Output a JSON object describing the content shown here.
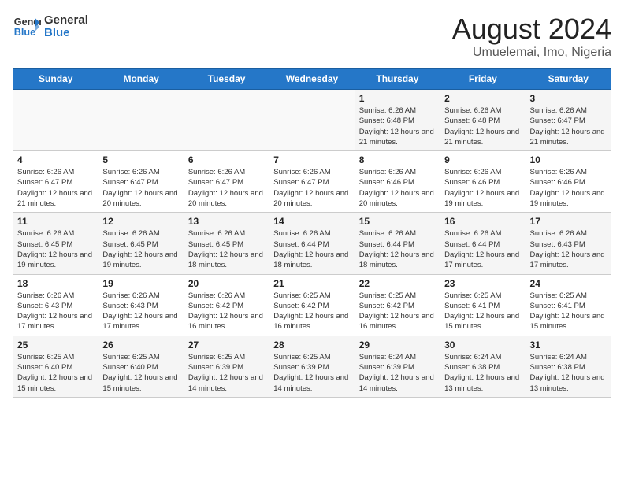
{
  "logo": {
    "line1": "General",
    "line2": "Blue"
  },
  "title": "August 2024",
  "subtitle": "Umuelemai, Imo, Nigeria",
  "weekdays": [
    "Sunday",
    "Monday",
    "Tuesday",
    "Wednesday",
    "Thursday",
    "Friday",
    "Saturday"
  ],
  "weeks": [
    [
      {
        "day": "",
        "info": ""
      },
      {
        "day": "",
        "info": ""
      },
      {
        "day": "",
        "info": ""
      },
      {
        "day": "",
        "info": ""
      },
      {
        "day": "1",
        "info": "Sunrise: 6:26 AM\nSunset: 6:48 PM\nDaylight: 12 hours and 21 minutes."
      },
      {
        "day": "2",
        "info": "Sunrise: 6:26 AM\nSunset: 6:48 PM\nDaylight: 12 hours and 21 minutes."
      },
      {
        "day": "3",
        "info": "Sunrise: 6:26 AM\nSunset: 6:47 PM\nDaylight: 12 hours and 21 minutes."
      }
    ],
    [
      {
        "day": "4",
        "info": "Sunrise: 6:26 AM\nSunset: 6:47 PM\nDaylight: 12 hours and 21 minutes."
      },
      {
        "day": "5",
        "info": "Sunrise: 6:26 AM\nSunset: 6:47 PM\nDaylight: 12 hours and 20 minutes."
      },
      {
        "day": "6",
        "info": "Sunrise: 6:26 AM\nSunset: 6:47 PM\nDaylight: 12 hours and 20 minutes."
      },
      {
        "day": "7",
        "info": "Sunrise: 6:26 AM\nSunset: 6:47 PM\nDaylight: 12 hours and 20 minutes."
      },
      {
        "day": "8",
        "info": "Sunrise: 6:26 AM\nSunset: 6:46 PM\nDaylight: 12 hours and 20 minutes."
      },
      {
        "day": "9",
        "info": "Sunrise: 6:26 AM\nSunset: 6:46 PM\nDaylight: 12 hours and 19 minutes."
      },
      {
        "day": "10",
        "info": "Sunrise: 6:26 AM\nSunset: 6:46 PM\nDaylight: 12 hours and 19 minutes."
      }
    ],
    [
      {
        "day": "11",
        "info": "Sunrise: 6:26 AM\nSunset: 6:45 PM\nDaylight: 12 hours and 19 minutes."
      },
      {
        "day": "12",
        "info": "Sunrise: 6:26 AM\nSunset: 6:45 PM\nDaylight: 12 hours and 19 minutes."
      },
      {
        "day": "13",
        "info": "Sunrise: 6:26 AM\nSunset: 6:45 PM\nDaylight: 12 hours and 18 minutes."
      },
      {
        "day": "14",
        "info": "Sunrise: 6:26 AM\nSunset: 6:44 PM\nDaylight: 12 hours and 18 minutes."
      },
      {
        "day": "15",
        "info": "Sunrise: 6:26 AM\nSunset: 6:44 PM\nDaylight: 12 hours and 18 minutes."
      },
      {
        "day": "16",
        "info": "Sunrise: 6:26 AM\nSunset: 6:44 PM\nDaylight: 12 hours and 17 minutes."
      },
      {
        "day": "17",
        "info": "Sunrise: 6:26 AM\nSunset: 6:43 PM\nDaylight: 12 hours and 17 minutes."
      }
    ],
    [
      {
        "day": "18",
        "info": "Sunrise: 6:26 AM\nSunset: 6:43 PM\nDaylight: 12 hours and 17 minutes."
      },
      {
        "day": "19",
        "info": "Sunrise: 6:26 AM\nSunset: 6:43 PM\nDaylight: 12 hours and 17 minutes."
      },
      {
        "day": "20",
        "info": "Sunrise: 6:26 AM\nSunset: 6:42 PM\nDaylight: 12 hours and 16 minutes."
      },
      {
        "day": "21",
        "info": "Sunrise: 6:25 AM\nSunset: 6:42 PM\nDaylight: 12 hours and 16 minutes."
      },
      {
        "day": "22",
        "info": "Sunrise: 6:25 AM\nSunset: 6:42 PM\nDaylight: 12 hours and 16 minutes."
      },
      {
        "day": "23",
        "info": "Sunrise: 6:25 AM\nSunset: 6:41 PM\nDaylight: 12 hours and 15 minutes."
      },
      {
        "day": "24",
        "info": "Sunrise: 6:25 AM\nSunset: 6:41 PM\nDaylight: 12 hours and 15 minutes."
      }
    ],
    [
      {
        "day": "25",
        "info": "Sunrise: 6:25 AM\nSunset: 6:40 PM\nDaylight: 12 hours and 15 minutes."
      },
      {
        "day": "26",
        "info": "Sunrise: 6:25 AM\nSunset: 6:40 PM\nDaylight: 12 hours and 15 minutes."
      },
      {
        "day": "27",
        "info": "Sunrise: 6:25 AM\nSunset: 6:39 PM\nDaylight: 12 hours and 14 minutes."
      },
      {
        "day": "28",
        "info": "Sunrise: 6:25 AM\nSunset: 6:39 PM\nDaylight: 12 hours and 14 minutes."
      },
      {
        "day": "29",
        "info": "Sunrise: 6:24 AM\nSunset: 6:39 PM\nDaylight: 12 hours and 14 minutes."
      },
      {
        "day": "30",
        "info": "Sunrise: 6:24 AM\nSunset: 6:38 PM\nDaylight: 12 hours and 13 minutes."
      },
      {
        "day": "31",
        "info": "Sunrise: 6:24 AM\nSunset: 6:38 PM\nDaylight: 12 hours and 13 minutes."
      }
    ]
  ]
}
